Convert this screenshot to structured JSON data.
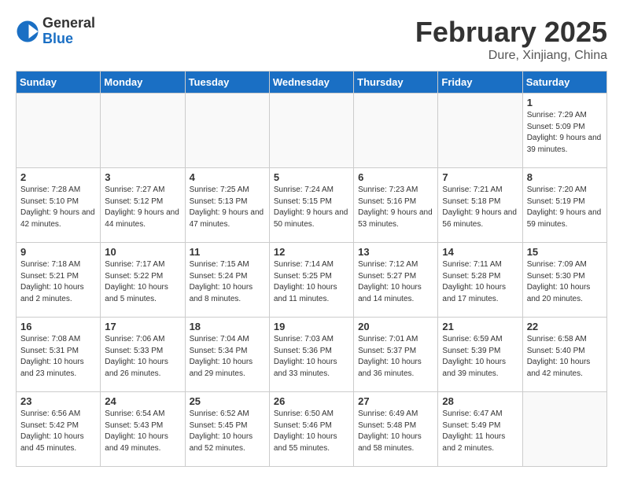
{
  "header": {
    "logo_general": "General",
    "logo_blue": "Blue",
    "month_title": "February 2025",
    "location": "Dure, Xinjiang, China"
  },
  "weekdays": [
    "Sunday",
    "Monday",
    "Tuesday",
    "Wednesday",
    "Thursday",
    "Friday",
    "Saturday"
  ],
  "weeks": [
    [
      {
        "day": "",
        "info": ""
      },
      {
        "day": "",
        "info": ""
      },
      {
        "day": "",
        "info": ""
      },
      {
        "day": "",
        "info": ""
      },
      {
        "day": "",
        "info": ""
      },
      {
        "day": "",
        "info": ""
      },
      {
        "day": "1",
        "info": "Sunrise: 7:29 AM\nSunset: 5:09 PM\nDaylight: 9 hours and 39 minutes."
      }
    ],
    [
      {
        "day": "2",
        "info": "Sunrise: 7:28 AM\nSunset: 5:10 PM\nDaylight: 9 hours and 42 minutes."
      },
      {
        "day": "3",
        "info": "Sunrise: 7:27 AM\nSunset: 5:12 PM\nDaylight: 9 hours and 44 minutes."
      },
      {
        "day": "4",
        "info": "Sunrise: 7:25 AM\nSunset: 5:13 PM\nDaylight: 9 hours and 47 minutes."
      },
      {
        "day": "5",
        "info": "Sunrise: 7:24 AM\nSunset: 5:15 PM\nDaylight: 9 hours and 50 minutes."
      },
      {
        "day": "6",
        "info": "Sunrise: 7:23 AM\nSunset: 5:16 PM\nDaylight: 9 hours and 53 minutes."
      },
      {
        "day": "7",
        "info": "Sunrise: 7:21 AM\nSunset: 5:18 PM\nDaylight: 9 hours and 56 minutes."
      },
      {
        "day": "8",
        "info": "Sunrise: 7:20 AM\nSunset: 5:19 PM\nDaylight: 9 hours and 59 minutes."
      }
    ],
    [
      {
        "day": "9",
        "info": "Sunrise: 7:18 AM\nSunset: 5:21 PM\nDaylight: 10 hours and 2 minutes."
      },
      {
        "day": "10",
        "info": "Sunrise: 7:17 AM\nSunset: 5:22 PM\nDaylight: 10 hours and 5 minutes."
      },
      {
        "day": "11",
        "info": "Sunrise: 7:15 AM\nSunset: 5:24 PM\nDaylight: 10 hours and 8 minutes."
      },
      {
        "day": "12",
        "info": "Sunrise: 7:14 AM\nSunset: 5:25 PM\nDaylight: 10 hours and 11 minutes."
      },
      {
        "day": "13",
        "info": "Sunrise: 7:12 AM\nSunset: 5:27 PM\nDaylight: 10 hours and 14 minutes."
      },
      {
        "day": "14",
        "info": "Sunrise: 7:11 AM\nSunset: 5:28 PM\nDaylight: 10 hours and 17 minutes."
      },
      {
        "day": "15",
        "info": "Sunrise: 7:09 AM\nSunset: 5:30 PM\nDaylight: 10 hours and 20 minutes."
      }
    ],
    [
      {
        "day": "16",
        "info": "Sunrise: 7:08 AM\nSunset: 5:31 PM\nDaylight: 10 hours and 23 minutes."
      },
      {
        "day": "17",
        "info": "Sunrise: 7:06 AM\nSunset: 5:33 PM\nDaylight: 10 hours and 26 minutes."
      },
      {
        "day": "18",
        "info": "Sunrise: 7:04 AM\nSunset: 5:34 PM\nDaylight: 10 hours and 29 minutes."
      },
      {
        "day": "19",
        "info": "Sunrise: 7:03 AM\nSunset: 5:36 PM\nDaylight: 10 hours and 33 minutes."
      },
      {
        "day": "20",
        "info": "Sunrise: 7:01 AM\nSunset: 5:37 PM\nDaylight: 10 hours and 36 minutes."
      },
      {
        "day": "21",
        "info": "Sunrise: 6:59 AM\nSunset: 5:39 PM\nDaylight: 10 hours and 39 minutes."
      },
      {
        "day": "22",
        "info": "Sunrise: 6:58 AM\nSunset: 5:40 PM\nDaylight: 10 hours and 42 minutes."
      }
    ],
    [
      {
        "day": "23",
        "info": "Sunrise: 6:56 AM\nSunset: 5:42 PM\nDaylight: 10 hours and 45 minutes."
      },
      {
        "day": "24",
        "info": "Sunrise: 6:54 AM\nSunset: 5:43 PM\nDaylight: 10 hours and 49 minutes."
      },
      {
        "day": "25",
        "info": "Sunrise: 6:52 AM\nSunset: 5:45 PM\nDaylight: 10 hours and 52 minutes."
      },
      {
        "day": "26",
        "info": "Sunrise: 6:50 AM\nSunset: 5:46 PM\nDaylight: 10 hours and 55 minutes."
      },
      {
        "day": "27",
        "info": "Sunrise: 6:49 AM\nSunset: 5:48 PM\nDaylight: 10 hours and 58 minutes."
      },
      {
        "day": "28",
        "info": "Sunrise: 6:47 AM\nSunset: 5:49 PM\nDaylight: 11 hours and 2 minutes."
      },
      {
        "day": "",
        "info": ""
      }
    ]
  ]
}
